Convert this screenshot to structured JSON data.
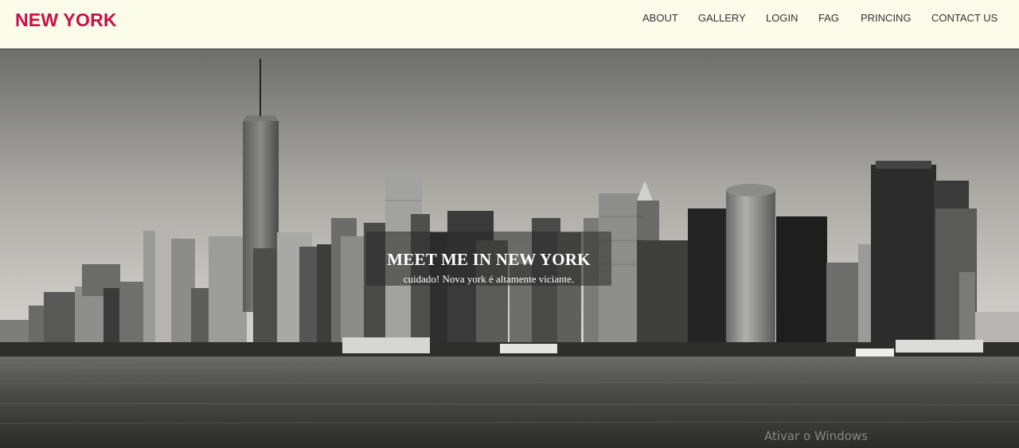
{
  "header": {
    "brand": "NEW YORK",
    "nav": [
      {
        "label": "ABOUT"
      },
      {
        "label": "GALLERY"
      },
      {
        "label": "LOGIN"
      },
      {
        "label": "FAG"
      },
      {
        "label": "PRINCING"
      },
      {
        "label": "CONTACT US"
      }
    ]
  },
  "hero": {
    "headline": "MEET ME IN NEW YORK",
    "tagline": "cuidado! Nova york é altamente viciante."
  },
  "system": {
    "watermark": "Ativar o Windows"
  },
  "colors": {
    "brand": "#c8104a",
    "header_bg": "#fcfcea",
    "nav_text": "#333333"
  }
}
